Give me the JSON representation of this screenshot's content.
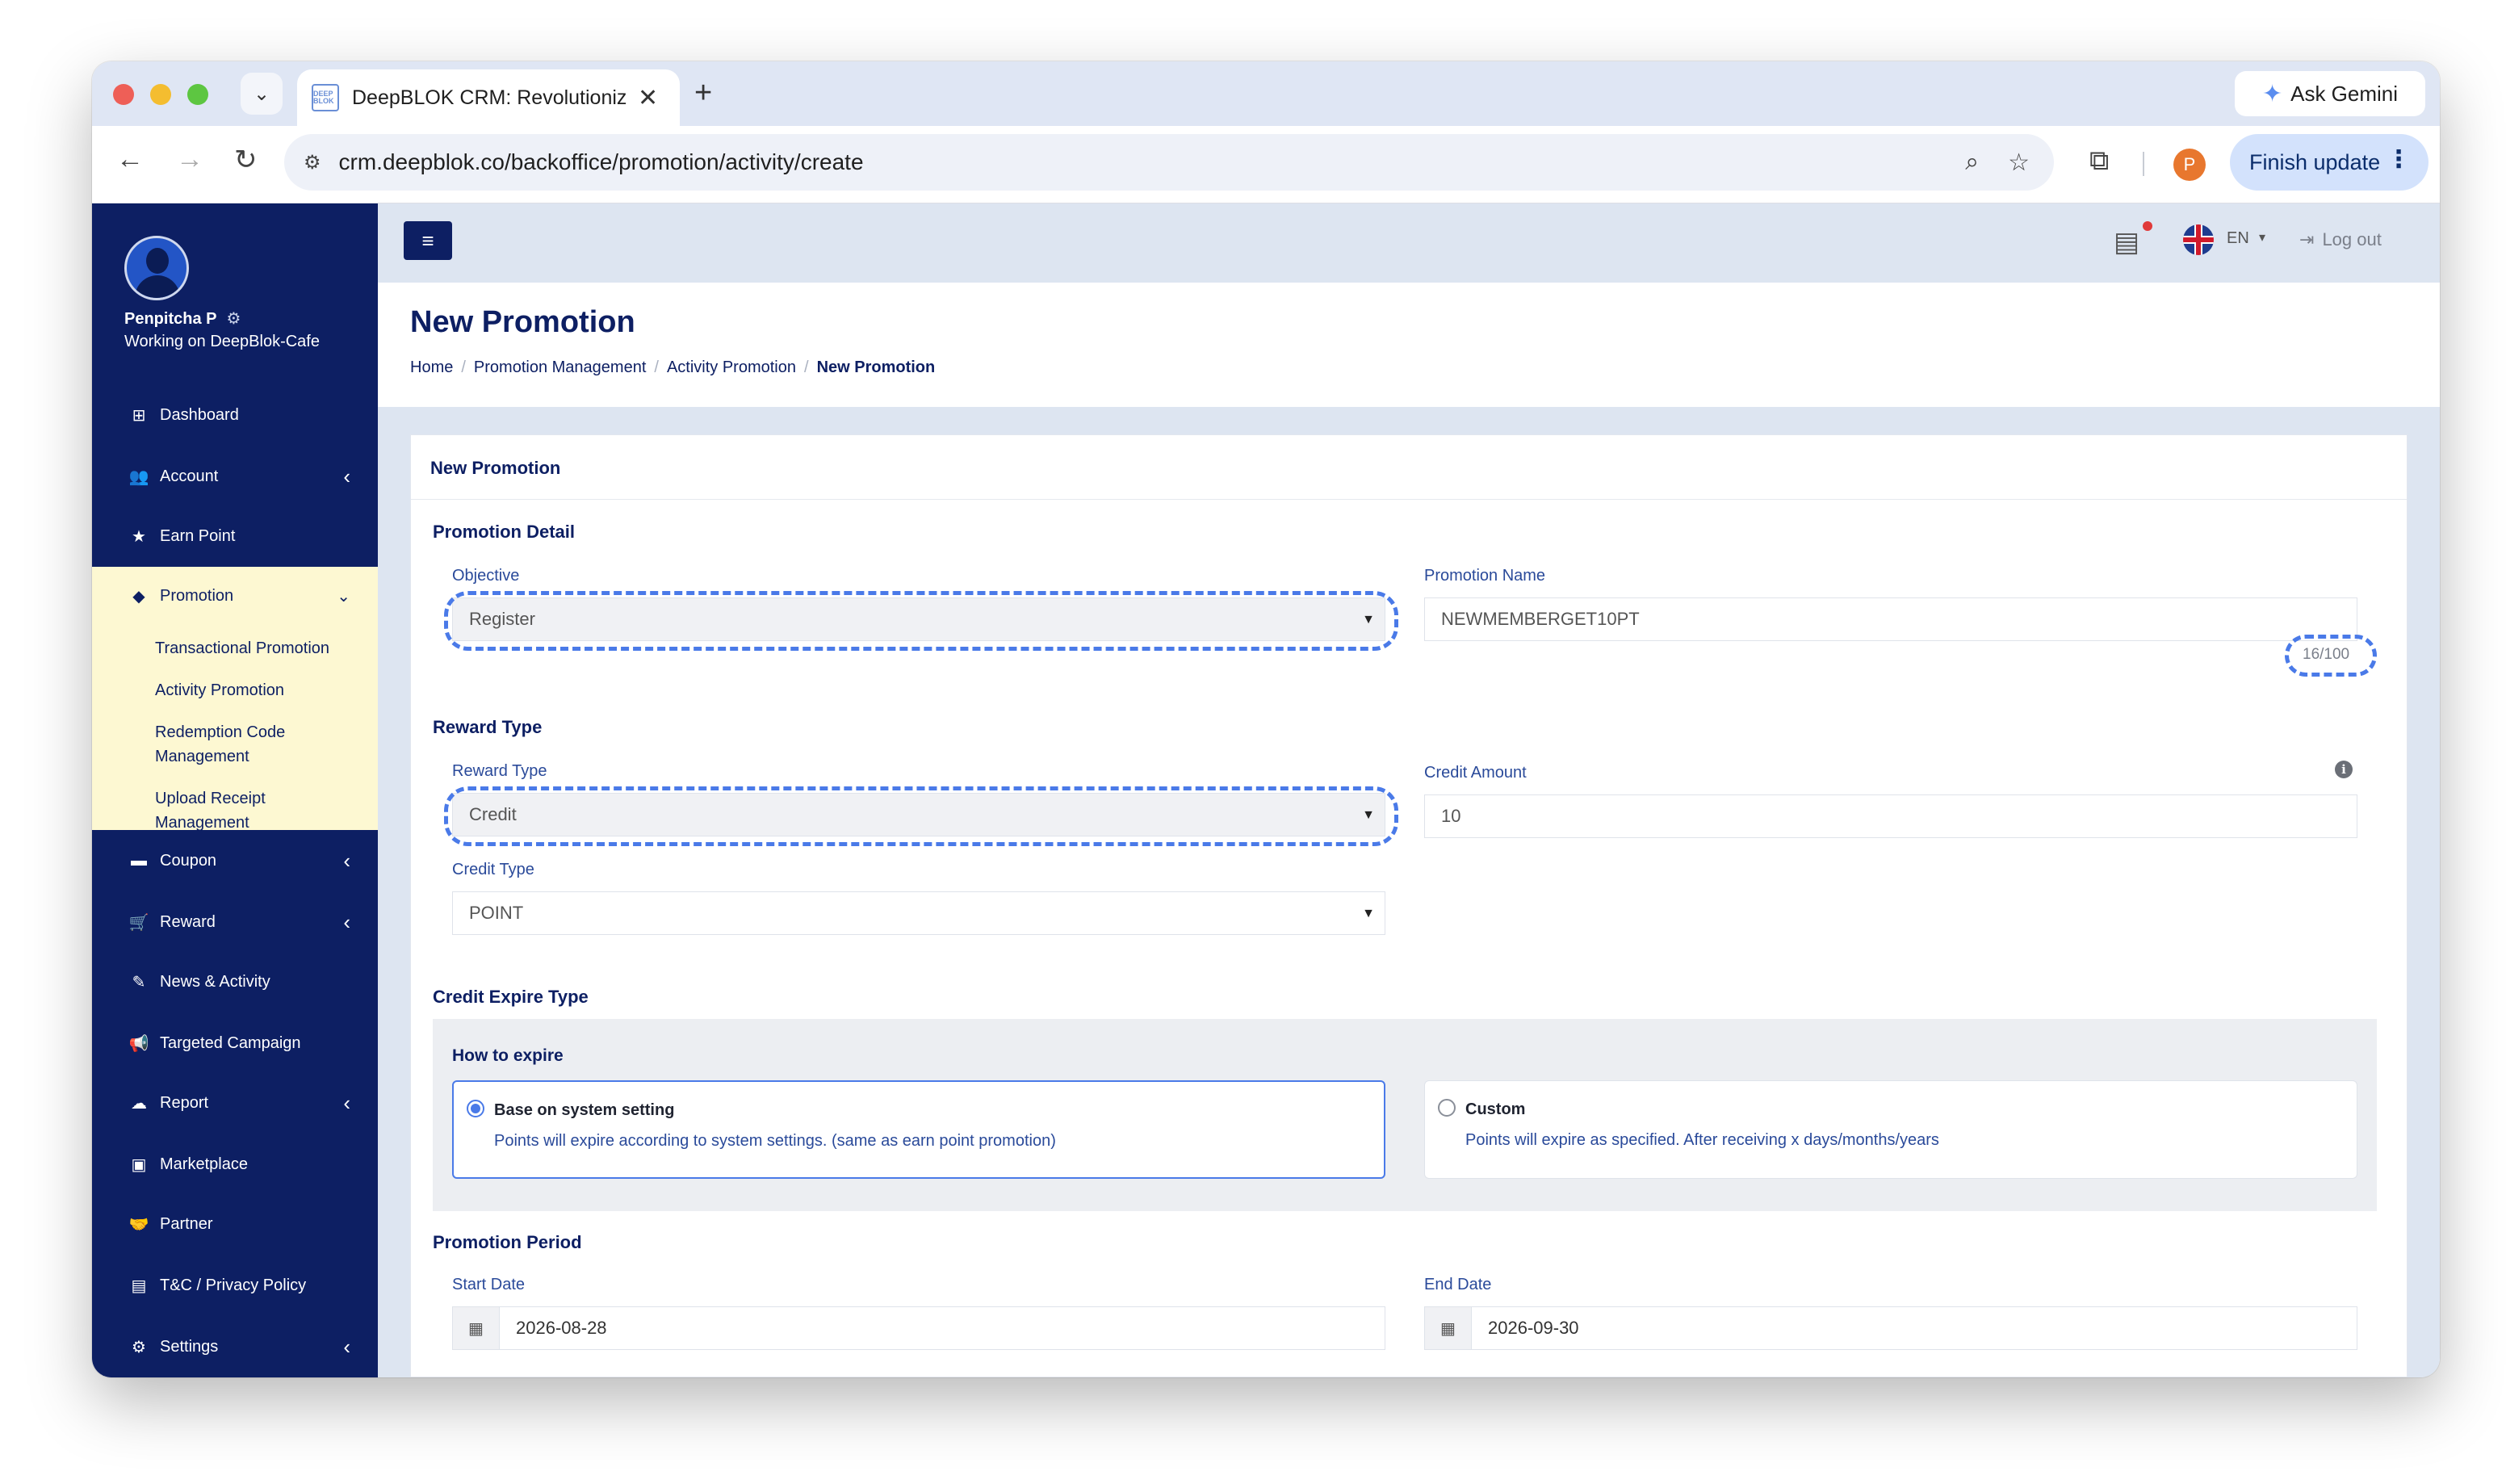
{
  "browser": {
    "tab_title": "DeepBLOK CRM: Revolutioniz",
    "favicon_text": "DEEP BLOK",
    "url": "crm.deepblok.co/backoffice/promotion/activity/create",
    "ask_gemini": "Ask Gemini",
    "finish_update": "Finish update",
    "profile_initial": "P"
  },
  "sidebar": {
    "user_name": "Penpitcha P",
    "workspace": "Working on DeepBlok-Cafe",
    "items": [
      {
        "label": "Dashboard",
        "icon": "dashboard-icon"
      },
      {
        "label": "Account",
        "icon": "users-icon"
      },
      {
        "label": "Earn Point",
        "icon": "star-icon"
      },
      {
        "label": "Promotion",
        "icon": "tag-icon"
      },
      {
        "label": "Coupon",
        "icon": "coupon-icon"
      },
      {
        "label": "Reward",
        "icon": "cart-icon"
      },
      {
        "label": "News & Activity",
        "icon": "edit-icon"
      },
      {
        "label": "Targeted Campaign",
        "icon": "megaphone-icon"
      },
      {
        "label": "Report",
        "icon": "cloud-icon"
      },
      {
        "label": "Marketplace",
        "icon": "bag-icon"
      },
      {
        "label": "Partner",
        "icon": "handshake-icon"
      },
      {
        "label": "T&C / Privacy Policy",
        "icon": "file-icon"
      },
      {
        "label": "Settings",
        "icon": "gear-icon"
      }
    ],
    "promotion_sub": [
      "Transactional Promotion",
      "Activity Promotion",
      "Redemption Code Management",
      "Upload Receipt Management"
    ]
  },
  "topbar": {
    "lang": "EN",
    "logout": "Log out"
  },
  "page": {
    "title": "New Promotion",
    "breadcrumb": [
      "Home",
      "Promotion Management",
      "Activity Promotion",
      "New Promotion"
    ]
  },
  "form": {
    "card_title": "New Promotion",
    "promotion_detail": "Promotion Detail",
    "objective_label": "Objective",
    "objective_value": "Register",
    "promotion_name_label": "Promotion Name",
    "promotion_name_value": "NEWMEMBERGET10PT",
    "name_counter": "16/100",
    "reward_type_section": "Reward Type",
    "reward_type_label": "Reward Type",
    "reward_type_value": "Credit",
    "credit_amount_label": "Credit Amount",
    "credit_amount_value": "10",
    "credit_type_label": "Credit Type",
    "credit_type_value": "POINT",
    "credit_expire_section": "Credit Expire Type",
    "how_to_expire": "How to expire",
    "option_system_title": "Base on system setting",
    "option_system_desc": "Points will expire according to system settings. (same as earn point promotion)",
    "option_custom_title": "Custom",
    "option_custom_desc": "Points will expire as specified. After receiving x days/months/years",
    "period_section": "Promotion Period",
    "start_date_label": "Start Date",
    "start_date_value": "2026-08-28",
    "end_date_label": "End Date",
    "end_date_value": "2026-09-30"
  },
  "colors": {
    "sidebar_bg": "#0d1f63",
    "submenu_bg": "#fdf8d2",
    "accent": "#4a7ae8",
    "content_bg": "#dde5f1"
  }
}
